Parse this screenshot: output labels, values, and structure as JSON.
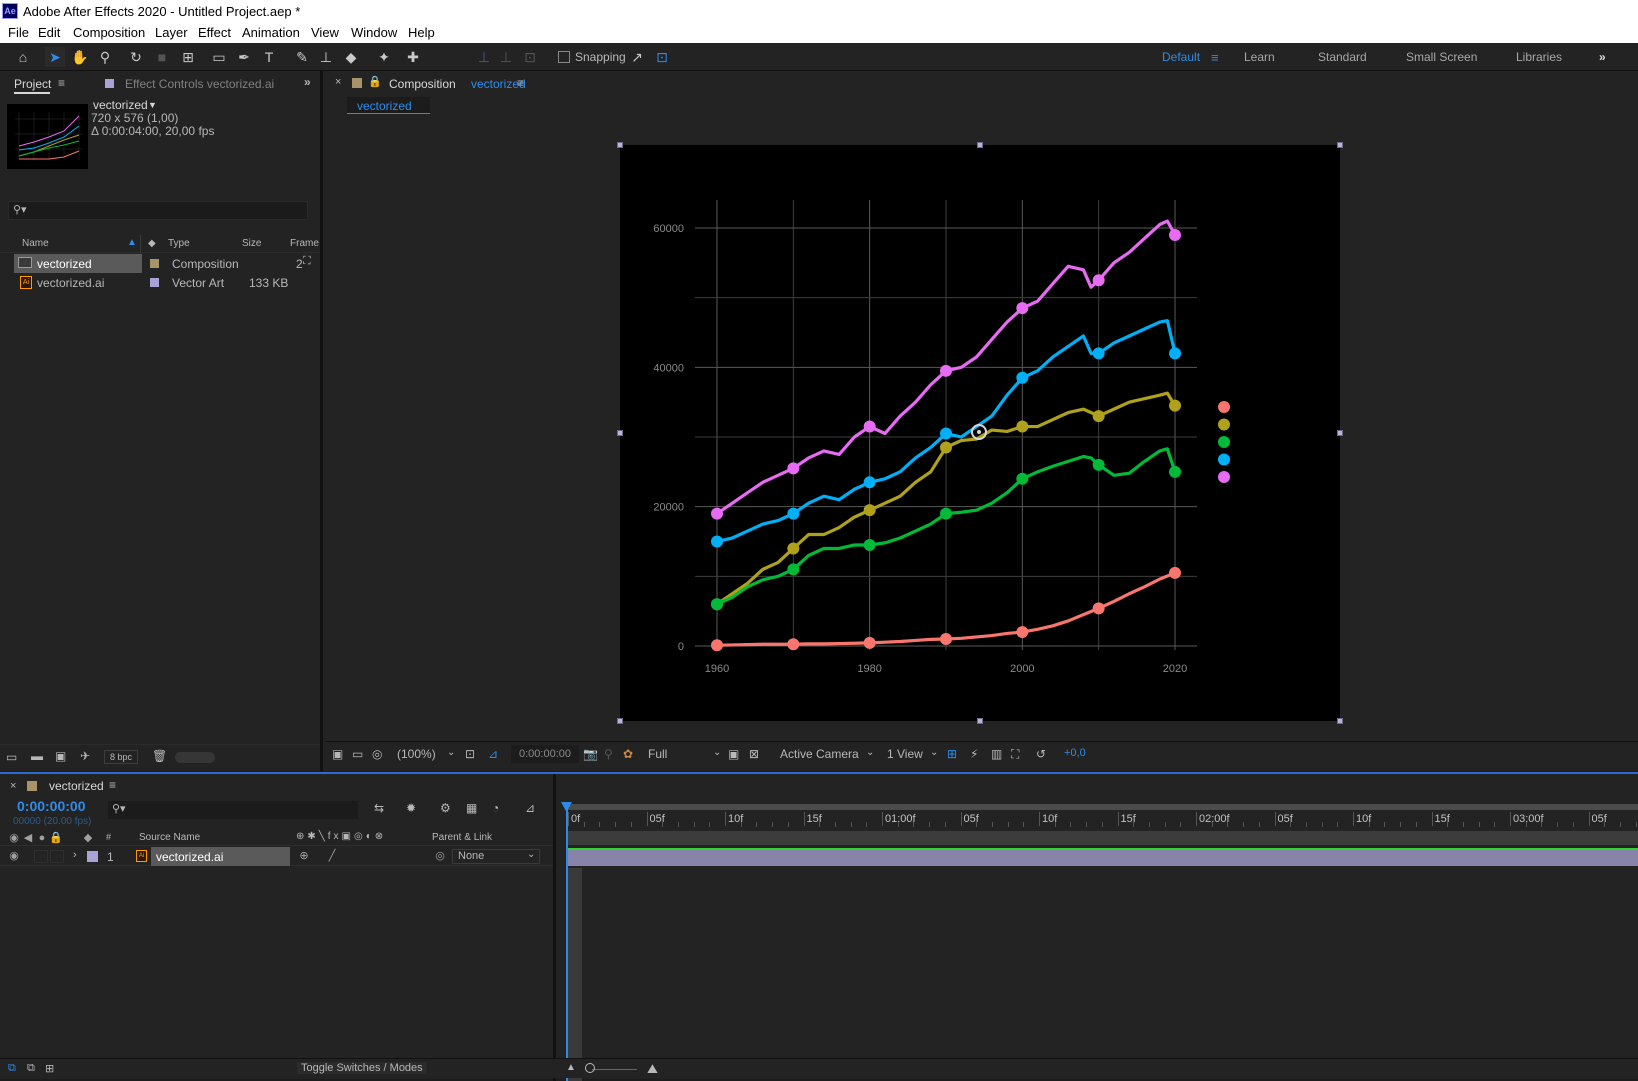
{
  "title_bar": {
    "app_icon": "Ae",
    "title": "Adobe After Effects 2020 - Untitled Project.aep *"
  },
  "menu": [
    "File",
    "Edit",
    "Composition",
    "Layer",
    "Effect",
    "Animation",
    "View",
    "Window",
    "Help"
  ],
  "toolbar": {
    "snapping_label": "Snapping",
    "workspaces": [
      "Default",
      "Learn",
      "Standard",
      "Small Screen",
      "Libraries"
    ],
    "active_workspace": "Default"
  },
  "project_panel": {
    "tab_project": "Project",
    "tab_effect_controls": "Effect Controls vectorized.ai",
    "item_name": "vectorized",
    "item_dims": "720 x 576 (1,00)",
    "item_duration": "Δ 0:00:04:00, 20,00 fps",
    "columns": {
      "name": "Name",
      "type": "Type",
      "size": "Size",
      "frame": "Frame"
    },
    "items": [
      {
        "name": "vectorized",
        "type": "Composition",
        "size": "",
        "frame": "2",
        "label_color": "#a89468",
        "icon": "composition-icon"
      },
      {
        "name": "vectorized.ai",
        "type": "Vector Art",
        "size": "133 KB",
        "frame": "",
        "label_color": "#a9a2d6",
        "icon": "illustrator-file-icon"
      }
    ],
    "bpc": "8 bpc"
  },
  "comp_panel": {
    "tab_prefix": "Composition",
    "tab_name": "vectorized",
    "breadcrumb": "vectorized",
    "zoom": "(100%)",
    "timecode": "0:00:00:00",
    "resolution": "Full",
    "camera": "Active Camera",
    "views": "1 View",
    "exposure": "+0,0"
  },
  "timeline": {
    "comp_name": "vectorized",
    "current_time": "0:00:00:00",
    "frame_info": "00000 (20.00 fps)",
    "col_num": "#",
    "col_source": "Source Name",
    "col_parent": "Parent & Link",
    "layer": {
      "index": "1",
      "name": "vectorized.ai",
      "parent": "None",
      "label_color": "#a9a2d6"
    },
    "ruler_labels": [
      "0f",
      "05f",
      "10f",
      "15f",
      "01:00f",
      "05f",
      "10f",
      "15f",
      "02:00f",
      "05f",
      "10f",
      "15f",
      "03:00f",
      "05f"
    ],
    "toggle_label": "Toggle Switches / Modes"
  },
  "chart_data": {
    "type": "line",
    "title": "",
    "xlabel": "",
    "ylabel": "",
    "xlim": [
      1960,
      2020
    ],
    "ylim": [
      0,
      60000
    ],
    "x_ticks": [
      1960,
      1980,
      2000,
      2020
    ],
    "y_ticks": [
      0,
      20000,
      40000,
      60000
    ],
    "grid": true,
    "legend_placement": "right",
    "series": [
      {
        "color": "#f8766d",
        "x": [
          1960,
          1962,
          1964,
          1966,
          1968,
          1970,
          1972,
          1974,
          1976,
          1978,
          1980,
          1982,
          1984,
          1986,
          1988,
          1990,
          1992,
          1994,
          1996,
          1998,
          2000,
          2002,
          2004,
          2006,
          2008,
          2010,
          2012,
          2014,
          2016,
          2018,
          2020
        ],
        "values": [
          100,
          150,
          200,
          250,
          250,
          250,
          300,
          300,
          350,
          400,
          450,
          550,
          650,
          800,
          950,
          1000,
          1100,
          1300,
          1500,
          1800,
          2000,
          2400,
          2900,
          3600,
          4500,
          5400,
          6400,
          7500,
          8500,
          9600,
          10500
        ]
      },
      {
        "color": "#b0a11a",
        "x": [
          1960,
          1962,
          1964,
          1966,
          1968,
          1970,
          1972,
          1974,
          1976,
          1978,
          1980,
          1982,
          1984,
          1986,
          1988,
          1990,
          1992,
          1994,
          1996,
          1998,
          2000,
          2002,
          2004,
          2006,
          2008,
          2010,
          2012,
          2014,
          2016,
          2018,
          2019,
          2020
        ],
        "values": [
          6000,
          7500,
          9000,
          11000,
          12000,
          14000,
          16000,
          16000,
          17000,
          18500,
          19500,
          20500,
          21500,
          23500,
          25000,
          28500,
          29500,
          29700,
          31000,
          30800,
          31500,
          31500,
          32500,
          33500,
          34000,
          33000,
          34000,
          35000,
          35500,
          36000,
          36300,
          34500
        ]
      },
      {
        "color": "#00ba38",
        "x": [
          1960,
          1962,
          1964,
          1966,
          1968,
          1970,
          1972,
          1974,
          1976,
          1978,
          1980,
          1982,
          1984,
          1986,
          1988,
          1990,
          1992,
          1994,
          1996,
          1998,
          2000,
          2002,
          2004,
          2006,
          2008,
          2009,
          2010,
          2012,
          2014,
          2016,
          2018,
          2019,
          2020
        ],
        "values": [
          6000,
          7000,
          8500,
          9500,
          10000,
          11000,
          13000,
          14000,
          14000,
          14500,
          14500,
          14800,
          15500,
          16500,
          17500,
          19000,
          19200,
          19500,
          20500,
          22000,
          24000,
          25000,
          25800,
          26500,
          27200,
          27000,
          26000,
          24500,
          24800,
          26500,
          28000,
          28300,
          25000
        ]
      },
      {
        "color": "#00b0f6",
        "x": [
          1960,
          1962,
          1964,
          1966,
          1968,
          1970,
          1972,
          1974,
          1976,
          1978,
          1980,
          1982,
          1984,
          1986,
          1988,
          1990,
          1992,
          1994,
          1996,
          1998,
          2000,
          2002,
          2004,
          2006,
          2008,
          2009,
          2010,
          2012,
          2014,
          2016,
          2018,
          2019,
          2020
        ],
        "values": [
          15000,
          15500,
          16500,
          17500,
          18000,
          19000,
          20500,
          21500,
          21000,
          22500,
          23500,
          24000,
          25000,
          27000,
          28500,
          30500,
          30000,
          31500,
          33000,
          36000,
          38500,
          39500,
          41500,
          43000,
          44500,
          42000,
          42000,
          43500,
          44500,
          45500,
          46500,
          46700,
          42000
        ]
      },
      {
        "color": "#e76bf3",
        "x": [
          1960,
          1962,
          1964,
          1966,
          1968,
          1970,
          1972,
          1974,
          1976,
          1978,
          1980,
          1982,
          1984,
          1986,
          1988,
          1990,
          1992,
          1994,
          1996,
          1998,
          2000,
          2002,
          2004,
          2006,
          2008,
          2009,
          2010,
          2012,
          2014,
          2016,
          2018,
          2019,
          2020
        ],
        "values": [
          19000,
          20500,
          22000,
          23500,
          24500,
          25500,
          27000,
          28000,
          27500,
          30000,
          31500,
          30500,
          33000,
          35000,
          37500,
          39500,
          40000,
          41500,
          44000,
          46500,
          48500,
          49500,
          52000,
          54500,
          54000,
          51500,
          52500,
          55000,
          56500,
          58500,
          60500,
          61000,
          59000
        ]
      }
    ]
  }
}
